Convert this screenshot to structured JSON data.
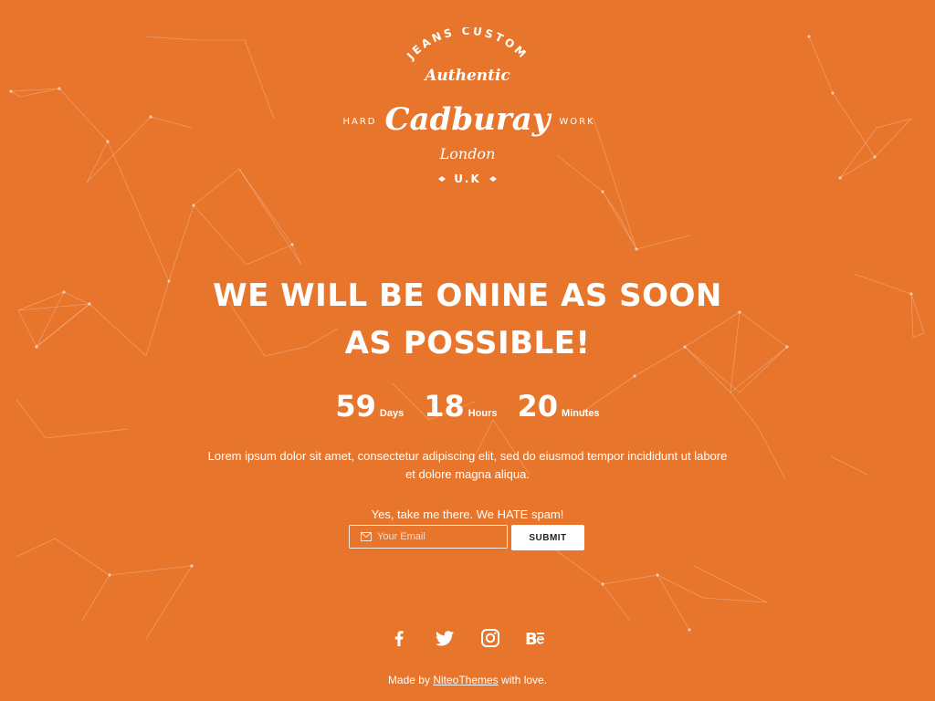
{
  "theme": {
    "background": "#E8752C",
    "text": "#FFFFFF",
    "button_bg": "#FFFFFF",
    "button_text": "#222222"
  },
  "logo": {
    "arc_text": "JEANS CUSTOM",
    "script_top": "Authentic",
    "left_word": "HARD",
    "brand": "Cadburay",
    "right_word": "WORK",
    "city": "London",
    "country": "U.K"
  },
  "headline": {
    "line1": "WE WILL BE ONINE AS SOON",
    "line2": "AS POSSIBLE!"
  },
  "countdown": [
    {
      "value": "59",
      "unit": "Days"
    },
    {
      "value": "18",
      "unit": "Hours"
    },
    {
      "value": "20",
      "unit": "Minutes"
    }
  ],
  "description": "Lorem ipsum dolor sit amet, consectetur adipiscing elit, sed do eiusmod tempor incididunt ut labore et dolore magna aliqua.",
  "subscribe": {
    "note": "Yes, take me there. We HATE spam!",
    "email_placeholder": "Your Email",
    "email_icon": "envelope-icon",
    "submit_label": "SUBMIT"
  },
  "social": [
    {
      "icon": "facebook-icon"
    },
    {
      "icon": "twitter-icon"
    },
    {
      "icon": "instagram-icon"
    },
    {
      "icon": "behance-icon"
    }
  ],
  "footer": {
    "prefix": "Made by",
    "link_text": "NiteoThemes",
    "suffix": "with love."
  }
}
